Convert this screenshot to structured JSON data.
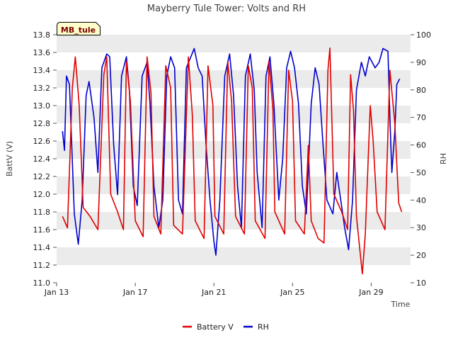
{
  "chart_data": {
    "type": "line",
    "title": "Mayberry Tule Tower: Volts and RH",
    "site_tag": "MB_tule",
    "xlabel": "Time",
    "ylabel_left": "BattV (V)",
    "ylabel_right": "RH",
    "x_ticks": [
      "Jan 13",
      "Jan 17",
      "Jan 21",
      "Jan 25",
      "Jan 29"
    ],
    "y_left_ticks": [
      "11.0",
      "11.2",
      "11.4",
      "11.6",
      "11.8",
      "12.0",
      "12.2",
      "12.4",
      "12.6",
      "12.8",
      "13.0",
      "13.2",
      "13.4",
      "13.6",
      "13.8"
    ],
    "y_right_ticks": [
      "10",
      "20",
      "30",
      "40",
      "50",
      "60",
      "70",
      "80",
      "90",
      "100"
    ],
    "y_left_range": [
      11.0,
      13.8
    ],
    "y_right_range": [
      10,
      100
    ],
    "x_range_days": [
      13,
      31
    ],
    "legend": [
      "Battery V",
      "RH"
    ],
    "legend_position": "bottom-center",
    "grid": "horizontal bands",
    "colors": {
      "battery": "#e00000",
      "rh": "#0000cc",
      "band": "#ebebeb",
      "tag_bg": "#ffffcc",
      "tag_text": "#7a0000"
    },
    "series": [
      {
        "name": "Battery V",
        "axis": "left",
        "points": [
          [
            13.3,
            11.75
          ],
          [
            13.55,
            11.62
          ],
          [
            13.8,
            13.2
          ],
          [
            13.95,
            13.55
          ],
          [
            14.15,
            13.0
          ],
          [
            14.35,
            11.85
          ],
          [
            14.7,
            11.75
          ],
          [
            15.1,
            11.6
          ],
          [
            15.4,
            13.35
          ],
          [
            15.55,
            13.55
          ],
          [
            15.75,
            12.0
          ],
          [
            16.1,
            11.8
          ],
          [
            16.4,
            11.6
          ],
          [
            16.55,
            13.5
          ],
          [
            16.75,
            13.05
          ],
          [
            17.0,
            11.7
          ],
          [
            17.4,
            11.52
          ],
          [
            17.6,
            13.55
          ],
          [
            17.8,
            13.15
          ],
          [
            17.95,
            11.75
          ],
          [
            18.3,
            11.55
          ],
          [
            18.55,
            13.45
          ],
          [
            18.8,
            13.2
          ],
          [
            18.95,
            11.65
          ],
          [
            19.4,
            11.55
          ],
          [
            19.7,
            13.55
          ],
          [
            19.9,
            12.9
          ],
          [
            20.05,
            11.7
          ],
          [
            20.5,
            11.5
          ],
          [
            20.7,
            13.45
          ],
          [
            20.95,
            13.0
          ],
          [
            21.05,
            11.75
          ],
          [
            21.5,
            11.55
          ],
          [
            21.7,
            13.5
          ],
          [
            21.9,
            13.05
          ],
          [
            22.1,
            11.75
          ],
          [
            22.55,
            11.55
          ],
          [
            22.75,
            13.45
          ],
          [
            22.95,
            13.2
          ],
          [
            23.1,
            11.7
          ],
          [
            23.6,
            11.5
          ],
          [
            23.8,
            13.5
          ],
          [
            24.0,
            12.95
          ],
          [
            24.1,
            11.8
          ],
          [
            24.6,
            11.55
          ],
          [
            24.8,
            13.4
          ],
          [
            25.0,
            13.05
          ],
          [
            25.15,
            11.7
          ],
          [
            25.6,
            11.55
          ],
          [
            25.8,
            12.55
          ],
          [
            25.95,
            11.7
          ],
          [
            26.3,
            11.5
          ],
          [
            26.6,
            11.45
          ],
          [
            26.8,
            13.4
          ],
          [
            26.9,
            13.65
          ],
          [
            27.1,
            12.0
          ],
          [
            27.5,
            11.8
          ],
          [
            27.8,
            11.6
          ],
          [
            27.95,
            13.35
          ],
          [
            28.1,
            12.95
          ],
          [
            28.25,
            11.75
          ],
          [
            28.55,
            11.1
          ],
          [
            28.7,
            11.55
          ],
          [
            28.95,
            13.0
          ],
          [
            29.1,
            12.6
          ],
          [
            29.3,
            11.8
          ],
          [
            29.7,
            11.6
          ],
          [
            29.95,
            13.4
          ],
          [
            30.2,
            12.8
          ],
          [
            30.4,
            11.9
          ],
          [
            30.55,
            11.8
          ]
        ]
      },
      {
        "name": "RH",
        "axis": "right",
        "points": [
          [
            13.3,
            65
          ],
          [
            13.4,
            58
          ],
          [
            13.5,
            85
          ],
          [
            13.65,
            82
          ],
          [
            13.9,
            35
          ],
          [
            14.1,
            24
          ],
          [
            14.3,
            40
          ],
          [
            14.5,
            78
          ],
          [
            14.65,
            83
          ],
          [
            14.9,
            70
          ],
          [
            15.1,
            50
          ],
          [
            15.3,
            88
          ],
          [
            15.55,
            93
          ],
          [
            15.7,
            92
          ],
          [
            15.9,
            60
          ],
          [
            16.1,
            42
          ],
          [
            16.3,
            85
          ],
          [
            16.55,
            92
          ],
          [
            16.7,
            80
          ],
          [
            16.9,
            45
          ],
          [
            17.1,
            38
          ],
          [
            17.35,
            85
          ],
          [
            17.6,
            90
          ],
          [
            17.75,
            75
          ],
          [
            17.95,
            45
          ],
          [
            18.2,
            30
          ],
          [
            18.4,
            40
          ],
          [
            18.6,
            85
          ],
          [
            18.8,
            92
          ],
          [
            19.0,
            88
          ],
          [
            19.2,
            40
          ],
          [
            19.4,
            35
          ],
          [
            19.6,
            88
          ],
          [
            20.0,
            95
          ],
          [
            20.2,
            88
          ],
          [
            20.4,
            85
          ],
          [
            20.6,
            60
          ],
          [
            20.8,
            40
          ],
          [
            21.0,
            25
          ],
          [
            21.1,
            20
          ],
          [
            21.3,
            40
          ],
          [
            21.55,
            85
          ],
          [
            21.8,
            93
          ],
          [
            22.0,
            78
          ],
          [
            22.2,
            45
          ],
          [
            22.4,
            30
          ],
          [
            22.6,
            85
          ],
          [
            22.85,
            93
          ],
          [
            23.05,
            80
          ],
          [
            23.2,
            50
          ],
          [
            23.45,
            30
          ],
          [
            23.65,
            85
          ],
          [
            23.85,
            92
          ],
          [
            24.05,
            75
          ],
          [
            24.3,
            40
          ],
          [
            24.5,
            55
          ],
          [
            24.7,
            88
          ],
          [
            24.9,
            94
          ],
          [
            25.1,
            88
          ],
          [
            25.3,
            75
          ],
          [
            25.5,
            45
          ],
          [
            25.7,
            35
          ],
          [
            25.95,
            75
          ],
          [
            26.15,
            88
          ],
          [
            26.35,
            82
          ],
          [
            26.55,
            60
          ],
          [
            26.75,
            40
          ],
          [
            27.05,
            35
          ],
          [
            27.25,
            50
          ],
          [
            27.45,
            40
          ],
          [
            27.65,
            30
          ],
          [
            27.85,
            22
          ],
          [
            28.05,
            40
          ],
          [
            28.25,
            80
          ],
          [
            28.5,
            90
          ],
          [
            28.7,
            85
          ],
          [
            28.9,
            92
          ],
          [
            29.2,
            88
          ],
          [
            29.4,
            90
          ],
          [
            29.6,
            95
          ],
          [
            29.85,
            94
          ],
          [
            29.95,
            70
          ],
          [
            30.05,
            50
          ],
          [
            30.2,
            65
          ],
          [
            30.3,
            82
          ],
          [
            30.45,
            84
          ]
        ]
      }
    ]
  }
}
